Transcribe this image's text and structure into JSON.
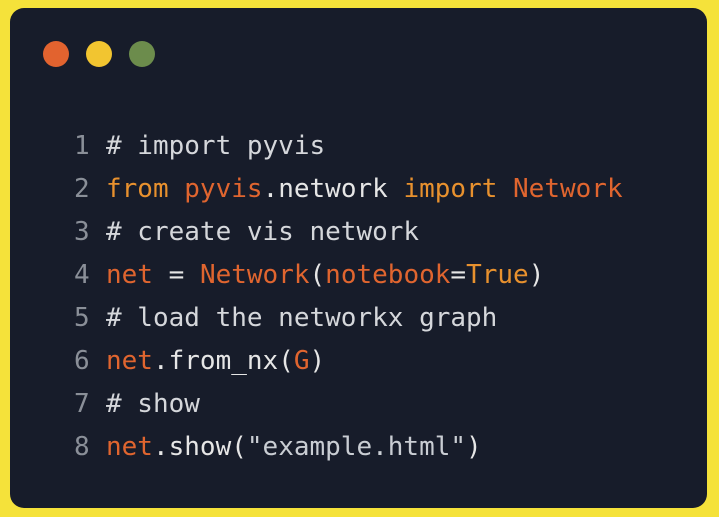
{
  "colors": {
    "background": "#f5e23a",
    "window": "#171c2a",
    "dot_red": "#e2632f",
    "dot_yellow": "#f2c530",
    "dot_green": "#6c8c4c",
    "line_number": "#8a8f98",
    "comment": "#d5d7db",
    "keyword": "#e8912e",
    "identifier": "#e0652f",
    "text": "#e6e6e6",
    "string": "#c9cdd3"
  },
  "window_controls": [
    {
      "name": "close-dot",
      "color": "#e2632f"
    },
    {
      "name": "minimize-dot",
      "color": "#f2c530"
    },
    {
      "name": "maximize-dot",
      "color": "#6c8c4c"
    }
  ],
  "code_lines": [
    {
      "number": "1",
      "tokens": [
        {
          "text": "# import pyvis",
          "kind": "comment"
        }
      ]
    },
    {
      "number": "2",
      "tokens": [
        {
          "text": "from",
          "kind": "keyword"
        },
        {
          "text": " ",
          "kind": "text"
        },
        {
          "text": "pyvis",
          "kind": "identifier"
        },
        {
          "text": ".network ",
          "kind": "text"
        },
        {
          "text": "import",
          "kind": "keyword"
        },
        {
          "text": " ",
          "kind": "text"
        },
        {
          "text": "Network",
          "kind": "identifier"
        }
      ]
    },
    {
      "number": "3",
      "tokens": [
        {
          "text": "# create vis network",
          "kind": "comment"
        }
      ]
    },
    {
      "number": "4",
      "tokens": [
        {
          "text": "net",
          "kind": "identifier"
        },
        {
          "text": " = ",
          "kind": "text"
        },
        {
          "text": "Network",
          "kind": "identifier"
        },
        {
          "text": "(",
          "kind": "text"
        },
        {
          "text": "notebook",
          "kind": "identifier"
        },
        {
          "text": "=",
          "kind": "text"
        },
        {
          "text": "True",
          "kind": "keyword"
        },
        {
          "text": ")",
          "kind": "text"
        }
      ]
    },
    {
      "number": "5",
      "tokens": [
        {
          "text": "# load the networkx graph",
          "kind": "comment"
        }
      ]
    },
    {
      "number": "6",
      "tokens": [
        {
          "text": "net",
          "kind": "identifier"
        },
        {
          "text": ".from_nx(",
          "kind": "text"
        },
        {
          "text": "G",
          "kind": "identifier"
        },
        {
          "text": ")",
          "kind": "text"
        }
      ]
    },
    {
      "number": "7",
      "tokens": [
        {
          "text": "# show",
          "kind": "comment"
        }
      ]
    },
    {
      "number": "8",
      "tokens": [
        {
          "text": "net",
          "kind": "identifier"
        },
        {
          "text": ".show(",
          "kind": "text"
        },
        {
          "text": "\"example.html\"",
          "kind": "string"
        },
        {
          "text": ")",
          "kind": "text"
        }
      ]
    }
  ]
}
